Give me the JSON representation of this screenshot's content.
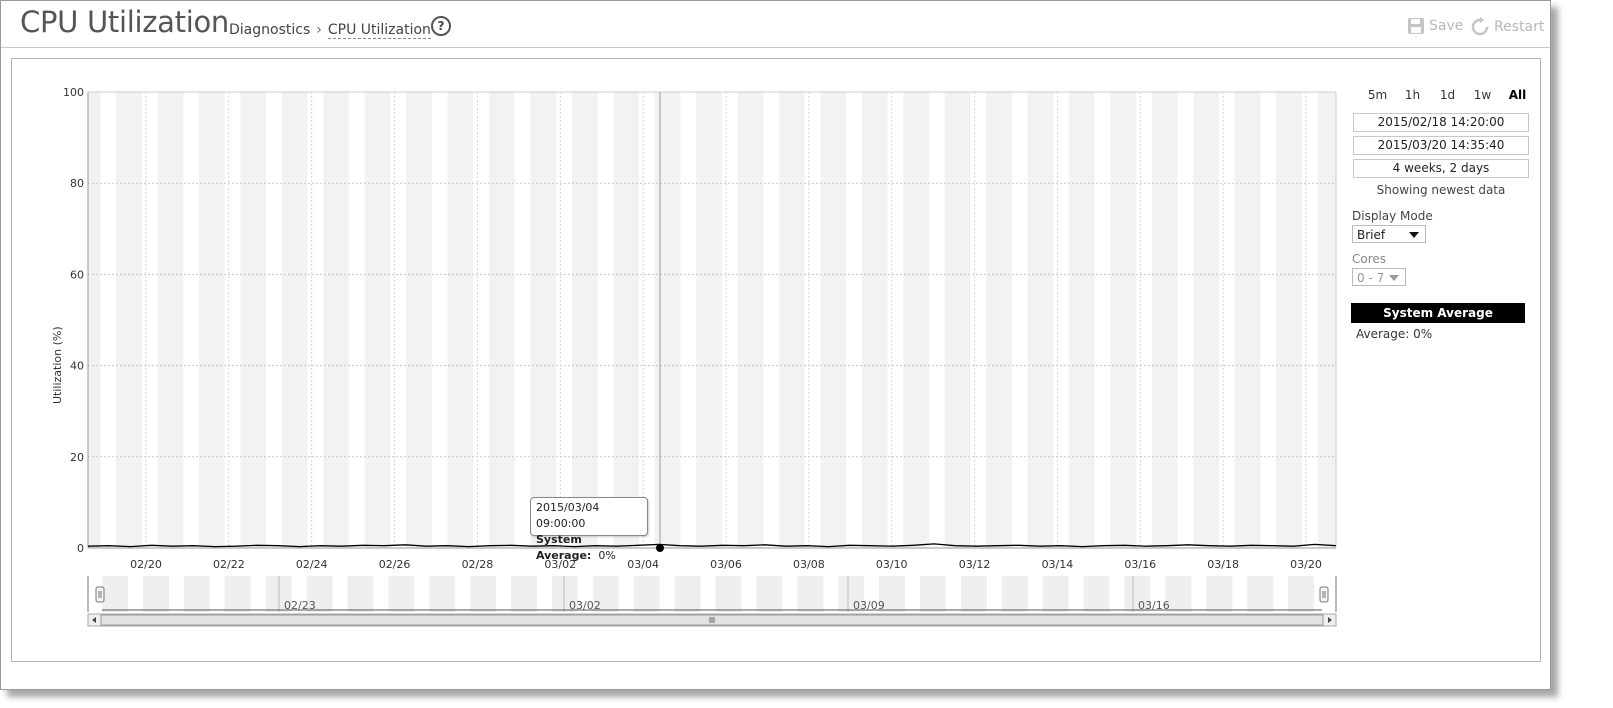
{
  "header": {
    "title": "CPU Utilization",
    "breadcrumb": [
      "Diagnostics",
      "CPU Utilization"
    ],
    "breadcrumb_sep": "›",
    "help_icon": "help-circle-icon",
    "save_label": "Save",
    "restart_label": "Restart",
    "save_icon": "floppy-disk-icon",
    "restart_icon": "refresh-icon"
  },
  "controls": {
    "ranges": [
      "5m",
      "1h",
      "1d",
      "1w",
      "All"
    ],
    "active_range": "All",
    "start_date": "2015/02/18 14:20:00",
    "end_date": "2015/03/20 14:35:40",
    "duration": "4 weeks, 2 days",
    "showing": "Showing newest data",
    "display_mode_label": "Display Mode",
    "display_mode_value": "Brief",
    "cores_label": "Cores",
    "cores_value": "0 - 7"
  },
  "legend": {
    "series_name": "System Average",
    "average_text": "Average: 0%",
    "color": "#000000"
  },
  "tooltip": {
    "time": "2015/03/04 09:00:00",
    "label": "System Average:",
    "value": "0%"
  },
  "chart_data": {
    "type": "line",
    "ylabel": "Utilization (%)",
    "ylim": [
      0,
      100
    ],
    "yticks": [
      "0",
      "20",
      "40",
      "60",
      "80",
      "100"
    ],
    "xticks": [
      "02/20",
      "02/22",
      "02/24",
      "02/26",
      "02/28",
      "03/02",
      "03/04",
      "03/06",
      "03/08",
      "03/10",
      "03/12",
      "03/14",
      "03/16",
      "03/18",
      "03/20"
    ],
    "navigator_ticks": [
      "02/23",
      "03/02",
      "03/09",
      "03/16"
    ],
    "x_range": [
      "2015/02/18 14:20:00",
      "2015/03/20 14:35:40"
    ],
    "series": [
      {
        "name": "System Average",
        "values": [
          0.4,
          0.5,
          0.3,
          0.6,
          0.4,
          0.5,
          0.3,
          0.4,
          0.6,
          0.5,
          0.3,
          0.5,
          0.4,
          0.6,
          0.5,
          0.7,
          0.4,
          0.5,
          0.3,
          0.5,
          0.6,
          0.4,
          0.5,
          0.3,
          0.5,
          0.4,
          0.6,
          0.8,
          0.5,
          0.4,
          0.6,
          0.5,
          0.7,
          0.4,
          0.5,
          0.3,
          0.6,
          0.5,
          0.4,
          0.6,
          0.9,
          0.5,
          0.4,
          0.5,
          0.6,
          0.4,
          0.5,
          0.3,
          0.5,
          0.6,
          0.4,
          0.5,
          0.7,
          0.5,
          0.4,
          0.6,
          0.5,
          0.4,
          0.8,
          0.5
        ]
      }
    ],
    "highlight_point": {
      "x": "2015/03/04 09:00:00",
      "y": 0
    },
    "grid": true
  }
}
